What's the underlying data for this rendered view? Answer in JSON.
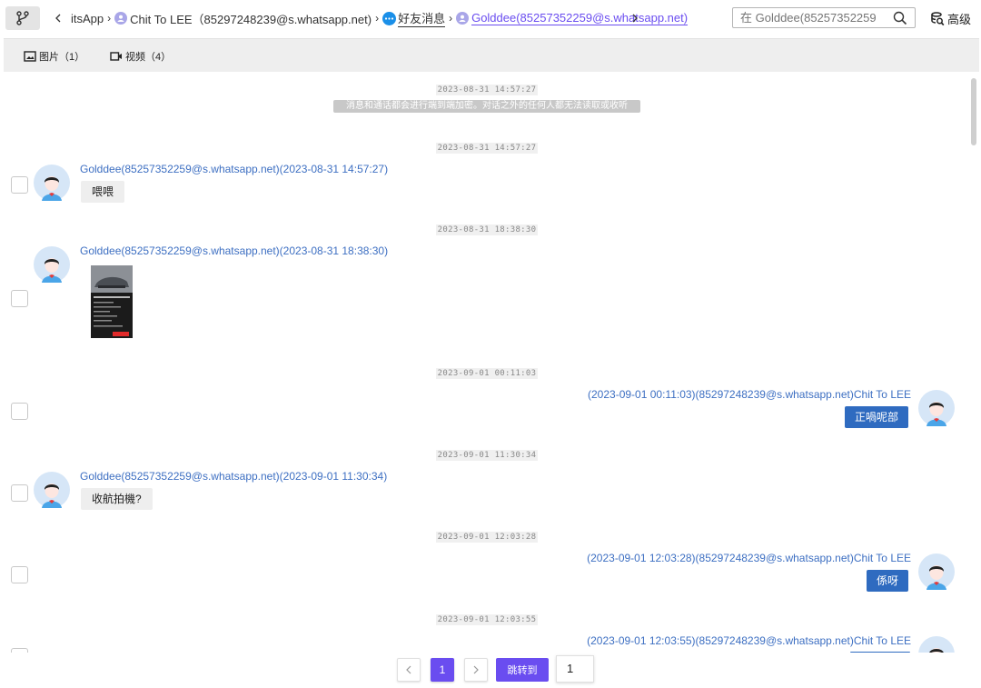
{
  "topbar": {
    "breadcrumbs": [
      {
        "label": "itsApp"
      },
      {
        "label": "Chit To LEE（85297248239@s.whatsapp.net)"
      },
      {
        "label": "好友消息"
      },
      {
        "label": "Golddee(85257352259@s.whatsapp.net)"
      }
    ],
    "search_placeholder": "在 Golddee(85257352259",
    "advanced_label": "高级"
  },
  "media_tabs": [
    {
      "label": "图片（1）"
    },
    {
      "label": "视频（4）"
    }
  ],
  "system_message": "消息和通话都会进行端到端加密。对话之外的任何人都无法读取或收听",
  "timestamps": [
    "2023-08-31 14:57:27",
    "2023-08-31 14:57:27",
    "2023-08-31 18:38:30",
    "2023-09-01 00:11:03",
    "2023-09-01 11:30:34",
    "2023-09-01 12:03:28",
    "2023-09-01 12:03:55"
  ],
  "messages": [
    {
      "sender": "Golddee(85257352259@s.whatsapp.net)(2023-08-31 14:57:27)",
      "text": "喂喂",
      "direction": "in"
    },
    {
      "sender": "Golddee(85257352259@s.whatsapp.net)(2023-08-31 18:38:30)",
      "text": "",
      "direction": "in",
      "kind": "image"
    },
    {
      "sender": "(2023-09-01 00:11:03)(85297248239@s.whatsapp.net)Chit To LEE",
      "text": "正喎呢部",
      "direction": "out"
    },
    {
      "sender": "Golddee(85257352259@s.whatsapp.net)(2023-09-01 11:30:34)",
      "text": "收航拍機?",
      "direction": "in"
    },
    {
      "sender": "(2023-09-01 12:03:28)(85297248239@s.whatsapp.net)Chit To LEE",
      "text": "係呀",
      "direction": "out"
    },
    {
      "sender": "(2023-09-01 12:03:55)(85297248239@s.whatsapp.net)Chit To LEE",
      "text": "",
      "direction": "out"
    }
  ],
  "pagination": {
    "prev": "<",
    "current_page": "1",
    "next": ">",
    "jump_label": "跳转到",
    "jump_value": "1"
  },
  "colors": {
    "accent": "#6a4df0",
    "sender_link": "#3d6fc2",
    "outgoing_bubble": "#2f6bc0"
  }
}
